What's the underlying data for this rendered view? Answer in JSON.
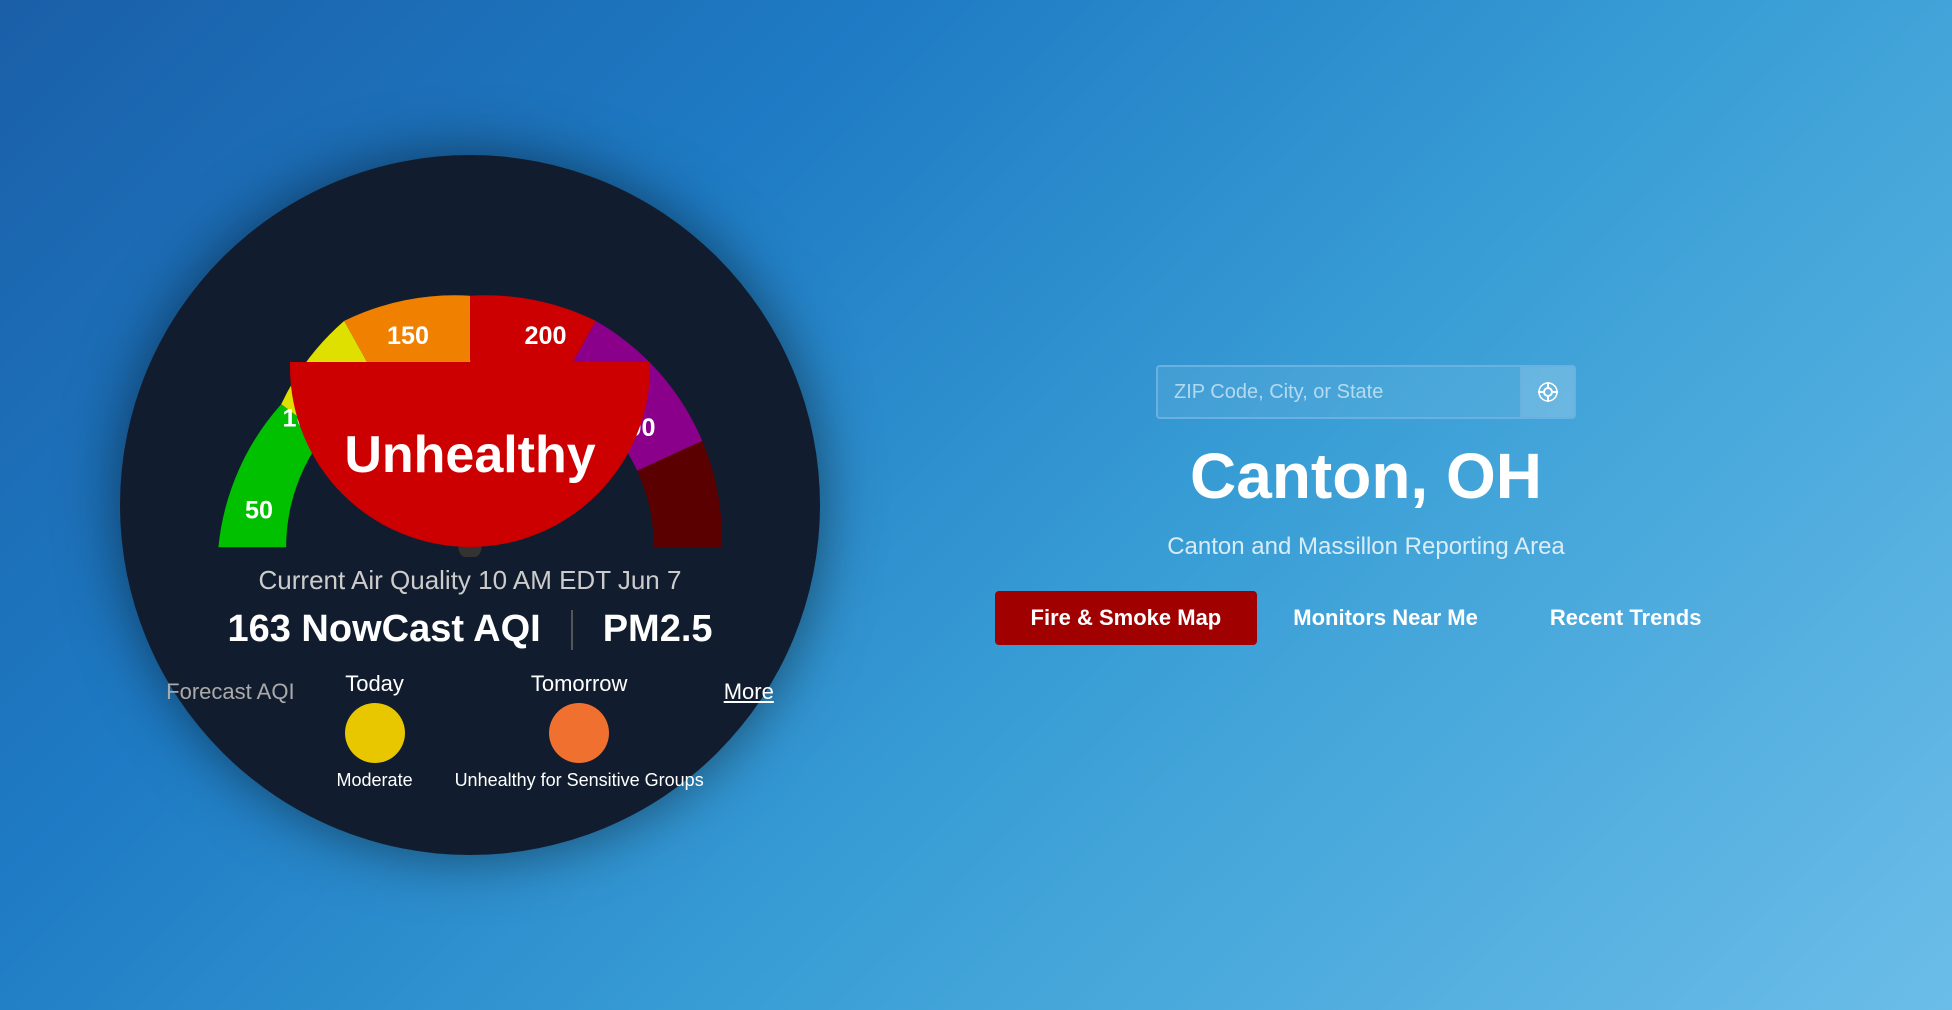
{
  "gauge": {
    "current_label": "Current Air Quality 10 AM EDT Jun 7",
    "aqi_value": "163 NowCast AQI",
    "pollutant": "PM2.5",
    "status": "Unhealthy",
    "arc_numbers": [
      "50",
      "100",
      "150",
      "200",
      "300"
    ],
    "forecast_label": "Forecast AQI",
    "today_label": "Today",
    "today_status": "Moderate",
    "today_color": "#e8c700",
    "tomorrow_label": "Tomorrow",
    "tomorrow_status": "Unhealthy for Sensitive Groups",
    "tomorrow_color": "#f07030",
    "more_label": "More"
  },
  "info": {
    "search_placeholder": "ZIP Code, City, or State",
    "city": "Canton, OH",
    "reporting_area": "Canton and Massillon Reporting Area",
    "tabs": [
      {
        "label": "Fire & Smoke Map",
        "active": true
      },
      {
        "label": "Monitors Near Me",
        "active": false
      },
      {
        "label": "Recent Trends",
        "active": false
      }
    ]
  }
}
